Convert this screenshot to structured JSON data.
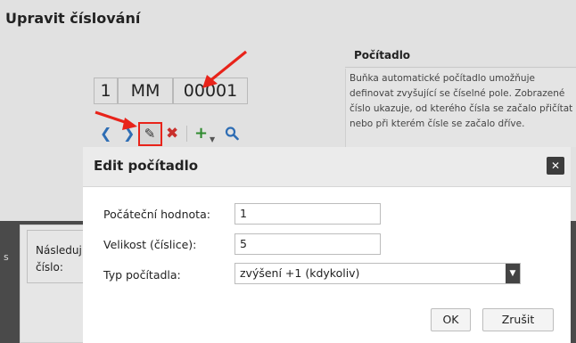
{
  "background": {
    "title": "Upravit číslování",
    "counter_parts": [
      "1",
      "MM",
      "00001"
    ],
    "next_label_line1": "Následuj",
    "next_label_line2": "číslo:",
    "side_fragment": "s"
  },
  "info": {
    "title": "Počítadlo",
    "text": "Buňka automatické počítadlo umožňuje definovat zvyšující se číselné pole. Zobrazené číslo ukazuje, od kterého čísla se začalo přičítat nebo při kterém čísle se začalo dříve."
  },
  "toolbar": {
    "icons": [
      "chevron-left-icon",
      "chevron-right-icon",
      "pencil-icon",
      "delete-icon",
      "add-icon",
      "search-icon"
    ]
  },
  "modal": {
    "title": "Edit počítadlo",
    "fields": [
      {
        "label": "Počáteční hodnota:",
        "value": "1"
      },
      {
        "label": "Velikost (číslice):",
        "value": "5"
      }
    ],
    "type_label": "Typ počítadla:",
    "type_value": "zvýšení +1 (kdykoliv)",
    "ok_label": "OK",
    "cancel_label": "Zrušit",
    "close_glyph": "✕"
  },
  "colors": {
    "arrow": "#e8231a",
    "highlight_border": "#e8231a",
    "blue_icon": "#2e6db4",
    "red_icon": "#c9302c",
    "green_icon": "#2f8a2f"
  }
}
